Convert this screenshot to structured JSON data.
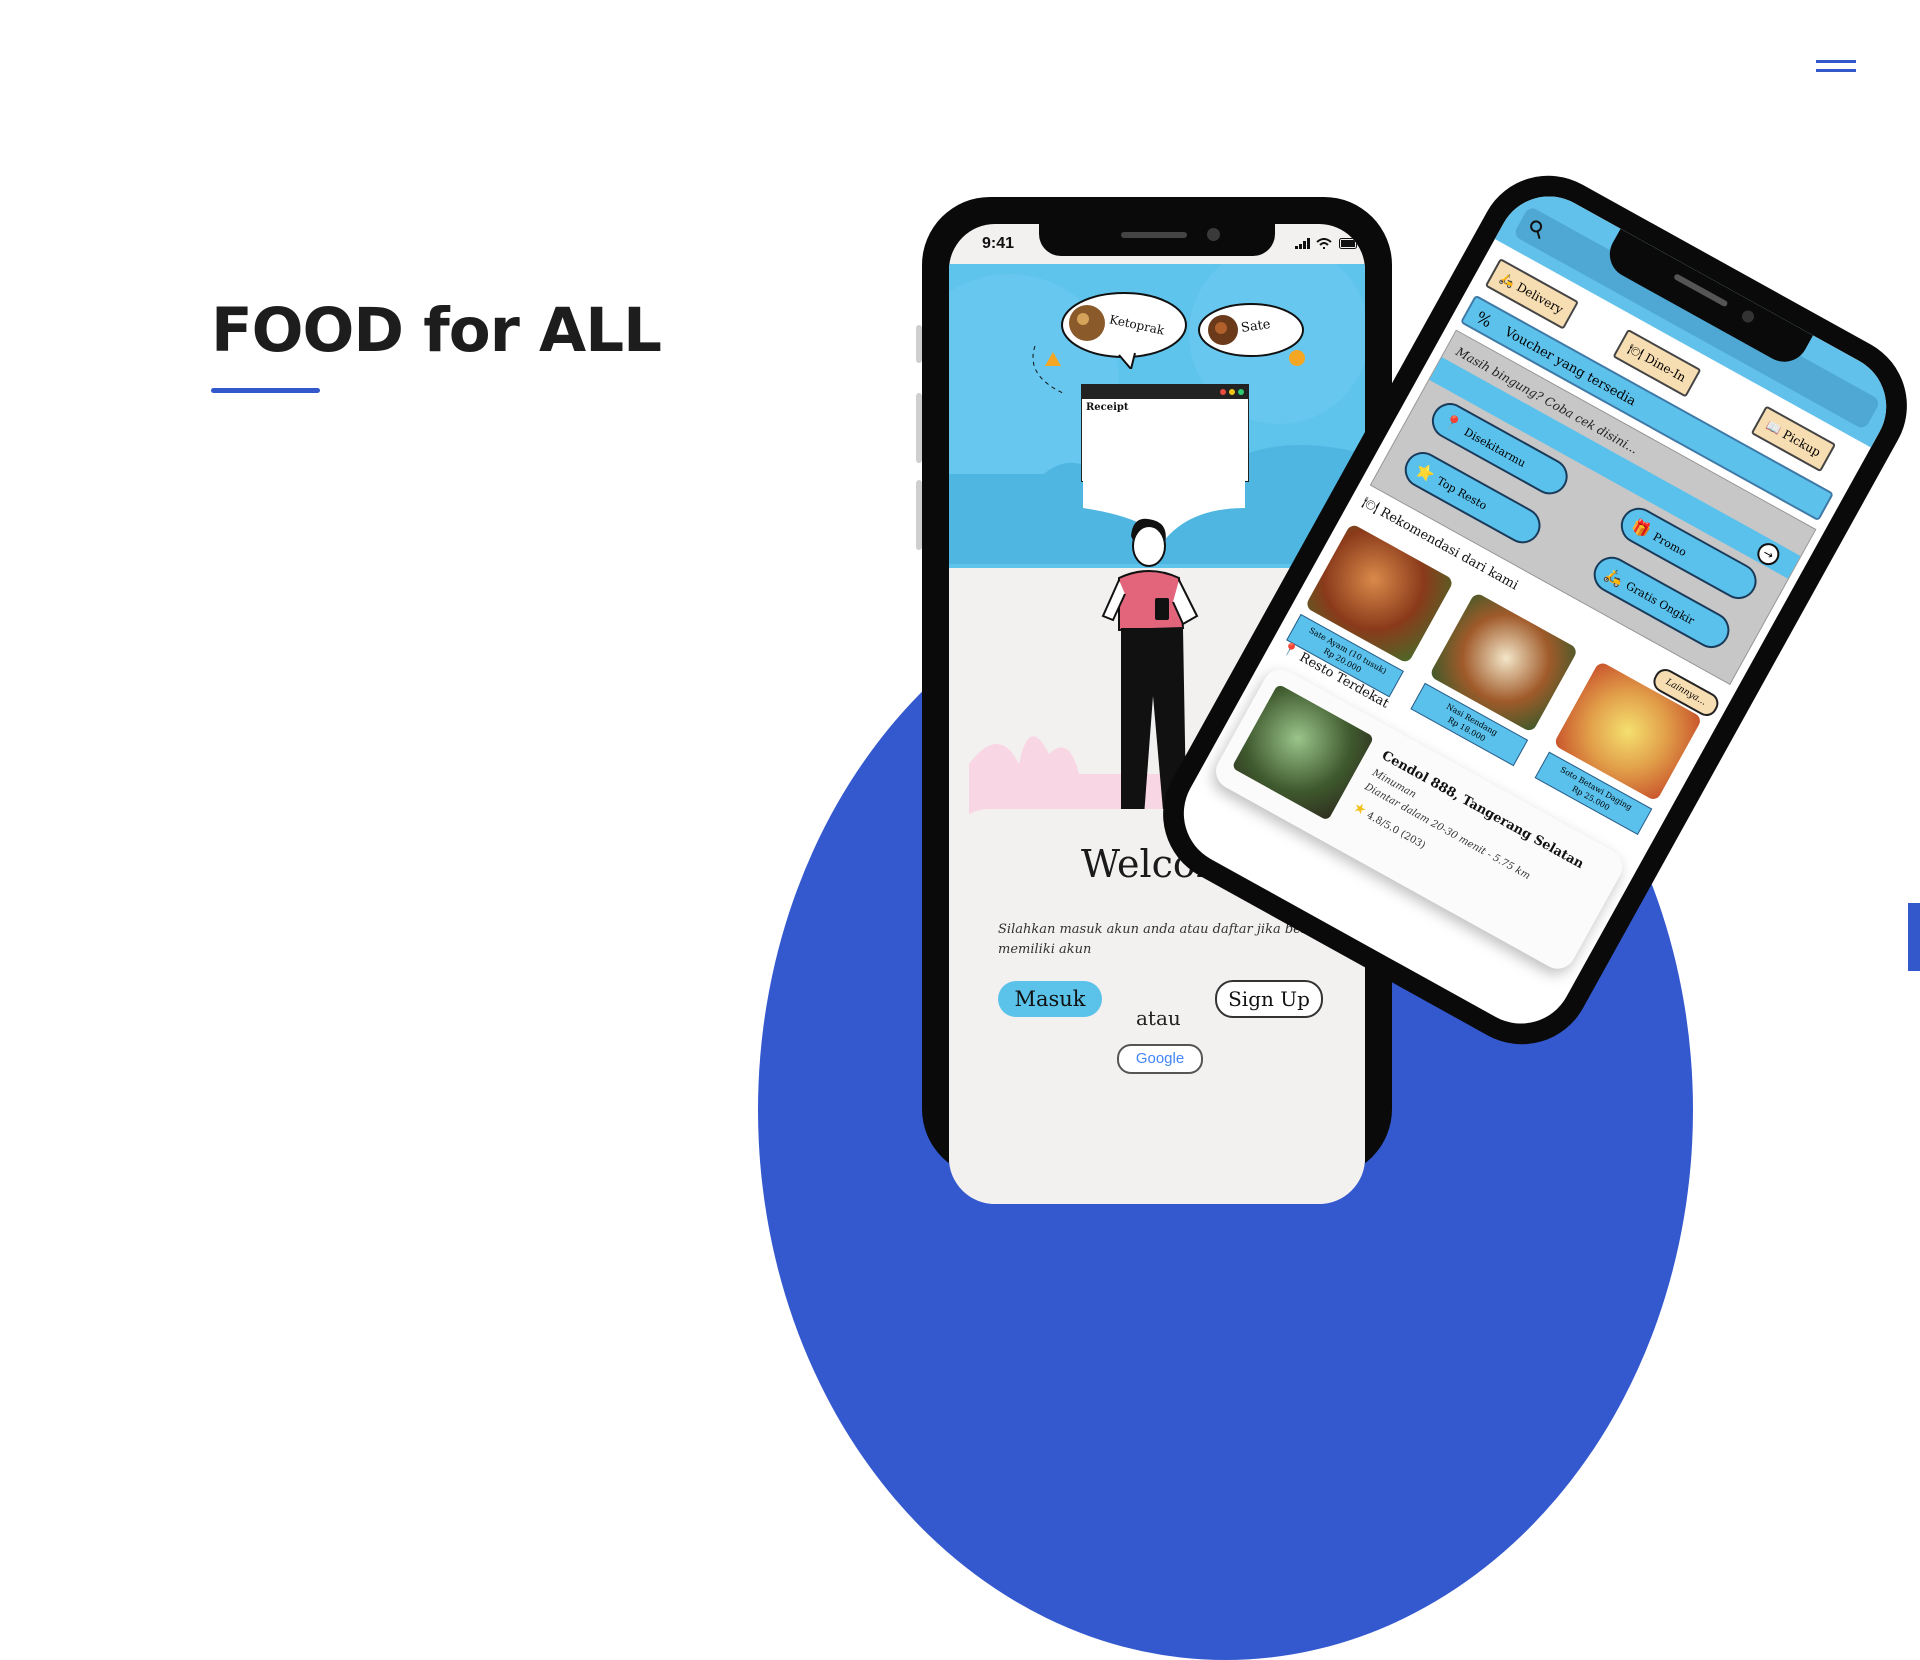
{
  "hero": {
    "title": "FOOD for ALL"
  },
  "phone1": {
    "status_time": "9:41",
    "bubble_left": "Ketoprak",
    "bubble_right": "Sate",
    "receipt_title": "Receipt",
    "welcome": "Welcome",
    "subtitle": "Silahkan masuk akun anda atau daftar jika belum memiliki akun",
    "login_label": "Masuk",
    "or_label": "atau",
    "signup_label": "Sign Up",
    "google_label": "Google"
  },
  "phone2": {
    "chips": [
      "Delivery",
      "Dine-In",
      "Pickup"
    ],
    "voucher": "Voucher yang tersedia",
    "confused": "Masih bingung? Coba cek disini...",
    "quick": [
      "Disekitarmu",
      "Promo",
      "Top Resto",
      "Gratis Ongkir"
    ],
    "recommend_title": "Rekomendasi dari kami",
    "more_label": "Lainnya...",
    "foods": [
      {
        "name": "Sate Ayam (10 tusuk)",
        "price": "Rp 20.000"
      },
      {
        "name": "Nasi Rendang",
        "price": "Rp 18.000"
      },
      {
        "name": "Soto Betawi Daging",
        "price": "Rp 25.000"
      }
    ],
    "nearest_title": "Resto Terdekat",
    "resto": {
      "name": "Cendol 888, Tangerang Selatan",
      "category": "Minuman",
      "delivery": "Diantar dalam 20-30 menit - 5.75 km",
      "rating": "4.8/5.0 (203)"
    }
  },
  "colors": {
    "accent": "#3358CC",
    "sky": "#5FC4EC",
    "chip": "#F7DDB2"
  }
}
